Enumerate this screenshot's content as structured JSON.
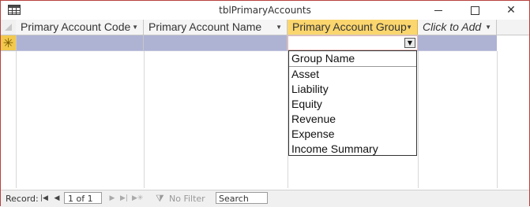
{
  "window": {
    "title": "tblPrimaryAccounts"
  },
  "columns": [
    {
      "label": "Primary Account Code"
    },
    {
      "label": "Primary Account Name"
    },
    {
      "label": "Primary Account Group"
    },
    {
      "label": "Click to Add"
    }
  ],
  "new_row_marker": "✳",
  "dropdown": {
    "header": "Group Name",
    "items": [
      "Asset",
      "Liability",
      "Equity",
      "Revenue",
      "Expense",
      "Income Summary"
    ]
  },
  "statusbar": {
    "record_label": "Record:",
    "record_position": "1 of 1",
    "filter_label": "No Filter",
    "search_value": "Search"
  },
  "colors": {
    "active_column": "#fbd66e",
    "new_row": "#aeb3d4",
    "border": "#b8413f"
  }
}
